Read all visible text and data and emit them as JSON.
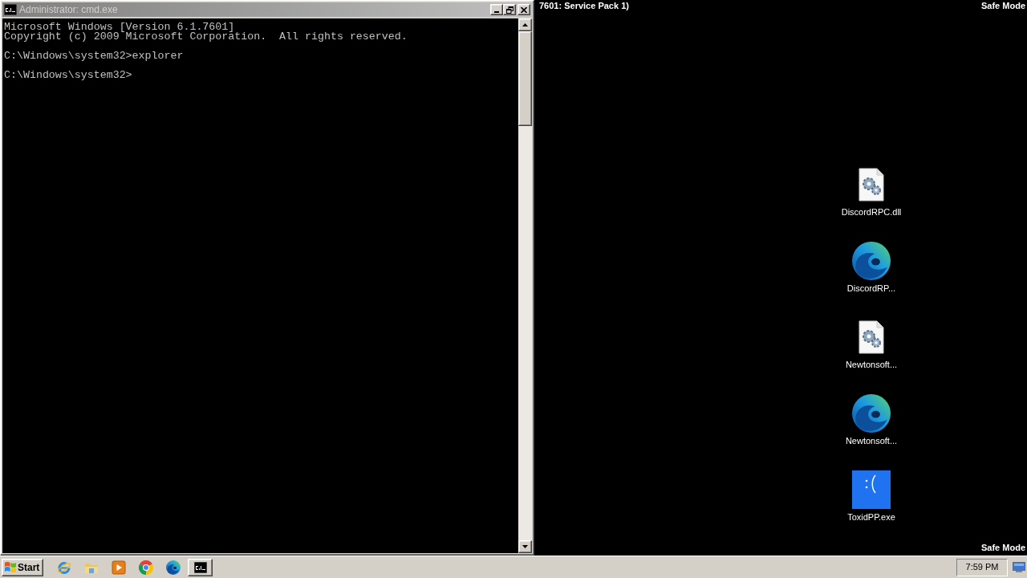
{
  "console_window": {
    "title": "Administrator: cmd.exe",
    "output_blocks": [
      [
        "Microsoft Windows [Version 6.1.7601]",
        "Copyright (c) 2009 Microsoft Corporation.  All rights reserved."
      ],
      [
        "C:\\Windows\\system32>explorer"
      ],
      [
        "C:\\Windows\\system32>"
      ]
    ]
  },
  "desktop": {
    "top_left_text": "7601: Service Pack 1)",
    "top_right_text": "Safe Mode",
    "bottom_right_text": "Safe Mode",
    "icons": [
      {
        "label": "DiscordRPC.dll",
        "kind": "file"
      },
      {
        "label": "DiscordRP...",
        "kind": "edge"
      },
      {
        "label": "Newtonsoft...",
        "kind": "file"
      },
      {
        "label": "Newtonsoft...",
        "kind": "edge"
      },
      {
        "label": "ToxidPP.exe",
        "kind": "sad"
      }
    ]
  },
  "taskbar": {
    "start_label": "Start",
    "quick_launch": [
      {
        "kind": "ie"
      },
      {
        "kind": "folder"
      },
      {
        "kind": "media"
      },
      {
        "kind": "chrome"
      },
      {
        "kind": "edge"
      }
    ],
    "tasks": [
      {
        "kind": "console"
      }
    ],
    "clock": "7:59 PM"
  }
}
